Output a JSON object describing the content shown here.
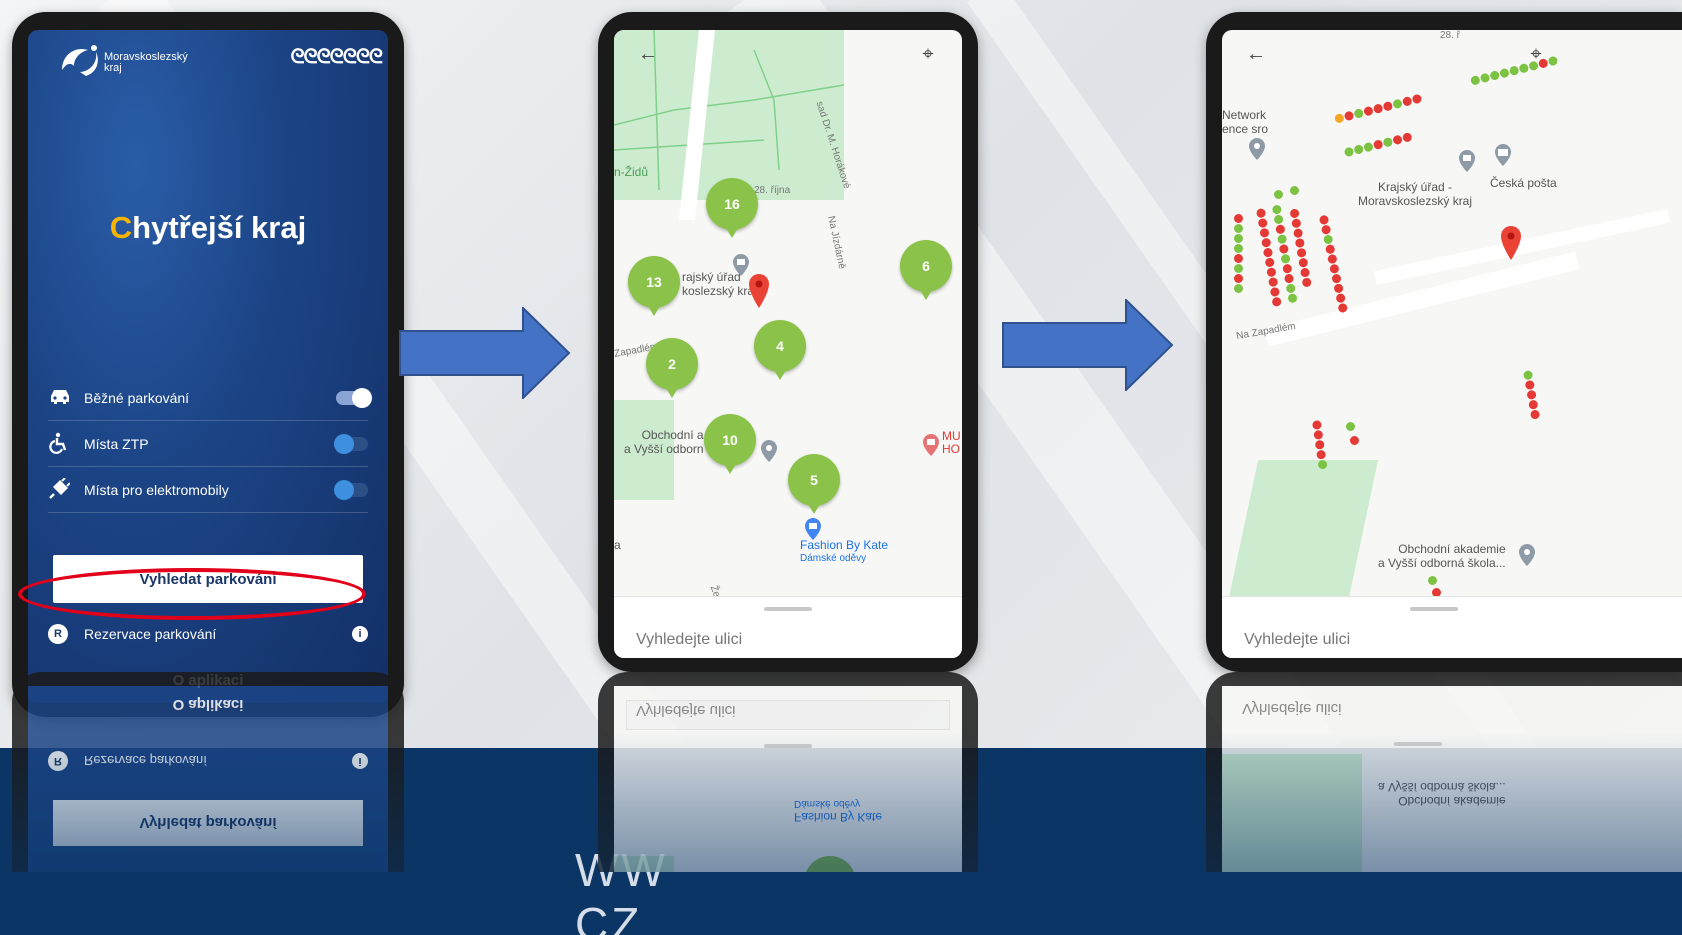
{
  "band": {
    "text_left": "WW",
    "text_right": "CZ"
  },
  "phone1": {
    "logo_text_line1": "Moravskoslezský",
    "logo_text_line2": "kraj",
    "title_first_letter": "C",
    "title_rest": "hytřejší kraj",
    "toggles": [
      {
        "label": "Běžné parkování",
        "state": "on",
        "icon": "car-icon"
      },
      {
        "label": "Místa ZTP",
        "state": "off",
        "icon": "wheelchair-icon"
      },
      {
        "label": "Místa pro elektromobily",
        "state": "off",
        "icon": "ev-plug-icon"
      }
    ],
    "search_button": "Vyhledat parkování",
    "reserve_badge": "R",
    "reserve_label": "Rezervace parkování",
    "info_badge": "i",
    "about_label": "O aplikaci",
    "highlight_color": "#e2001a"
  },
  "phone2": {
    "back_icon": "←",
    "locate_icon": "⌖",
    "labels": {
      "street1": "sad Dr. M. Horákové",
      "street2": "28. října",
      "street3": "Na Jízdárně",
      "street4": "Zapadlém",
      "area1": "n-Židů",
      "poi1_line1": "rajský úřad",
      "poi1_line2": "koslezský kraj",
      "poi2_line1": "Obchodní a",
      "poi2_line2": "a Vyšší odborn",
      "poi3_line1": "Fashion By Kate",
      "poi3_line2": "Dámské oděvy",
      "poi4_line1": "MU",
      "poi4_line2": "HO",
      "edge_a": "a",
      "edge_street": "Želez"
    },
    "clusters": [
      "16",
      "13",
      "6",
      "2",
      "4",
      "10",
      "5"
    ],
    "search_placeholder": "Vyhledejte ulici"
  },
  "phone3": {
    "back_icon": "←",
    "locate_icon": "⌖",
    "labels": {
      "poi1_line1": "Network",
      "poi1_line2": "ence sro",
      "poi2_line1": "Krajský úřad -",
      "poi2_line2": "Moravskoslezský kraj",
      "poi3": "Česká pošta",
      "street": "Na Zapadlém",
      "poi4_line1": "Obchodní akademie",
      "poi4_line2": "a Vyšší odborná škola...",
      "top_street": "28. ř"
    },
    "search_placeholder": "Vyhledejte ulici"
  }
}
